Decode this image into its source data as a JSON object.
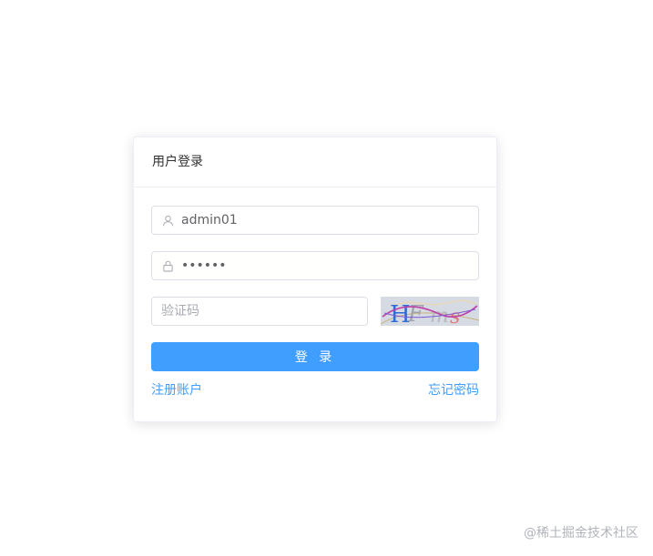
{
  "login_card": {
    "title": "用户登录",
    "username": {
      "value": "admin01",
      "icon": "user-icon"
    },
    "password": {
      "value": "••••••",
      "icon": "lock-icon"
    },
    "captcha": {
      "placeholder": "验证码",
      "image_text": "HFms"
    },
    "submit_label": "登 录",
    "register_link": "注册账户",
    "forgot_link": "忘记密码"
  },
  "watermark": "@稀土掘金技术社区",
  "colors": {
    "primary": "#409eff",
    "border": "#dcdfe6",
    "divider": "#ebeef5",
    "text": "#303133",
    "watermark": "#b0b4bb"
  }
}
